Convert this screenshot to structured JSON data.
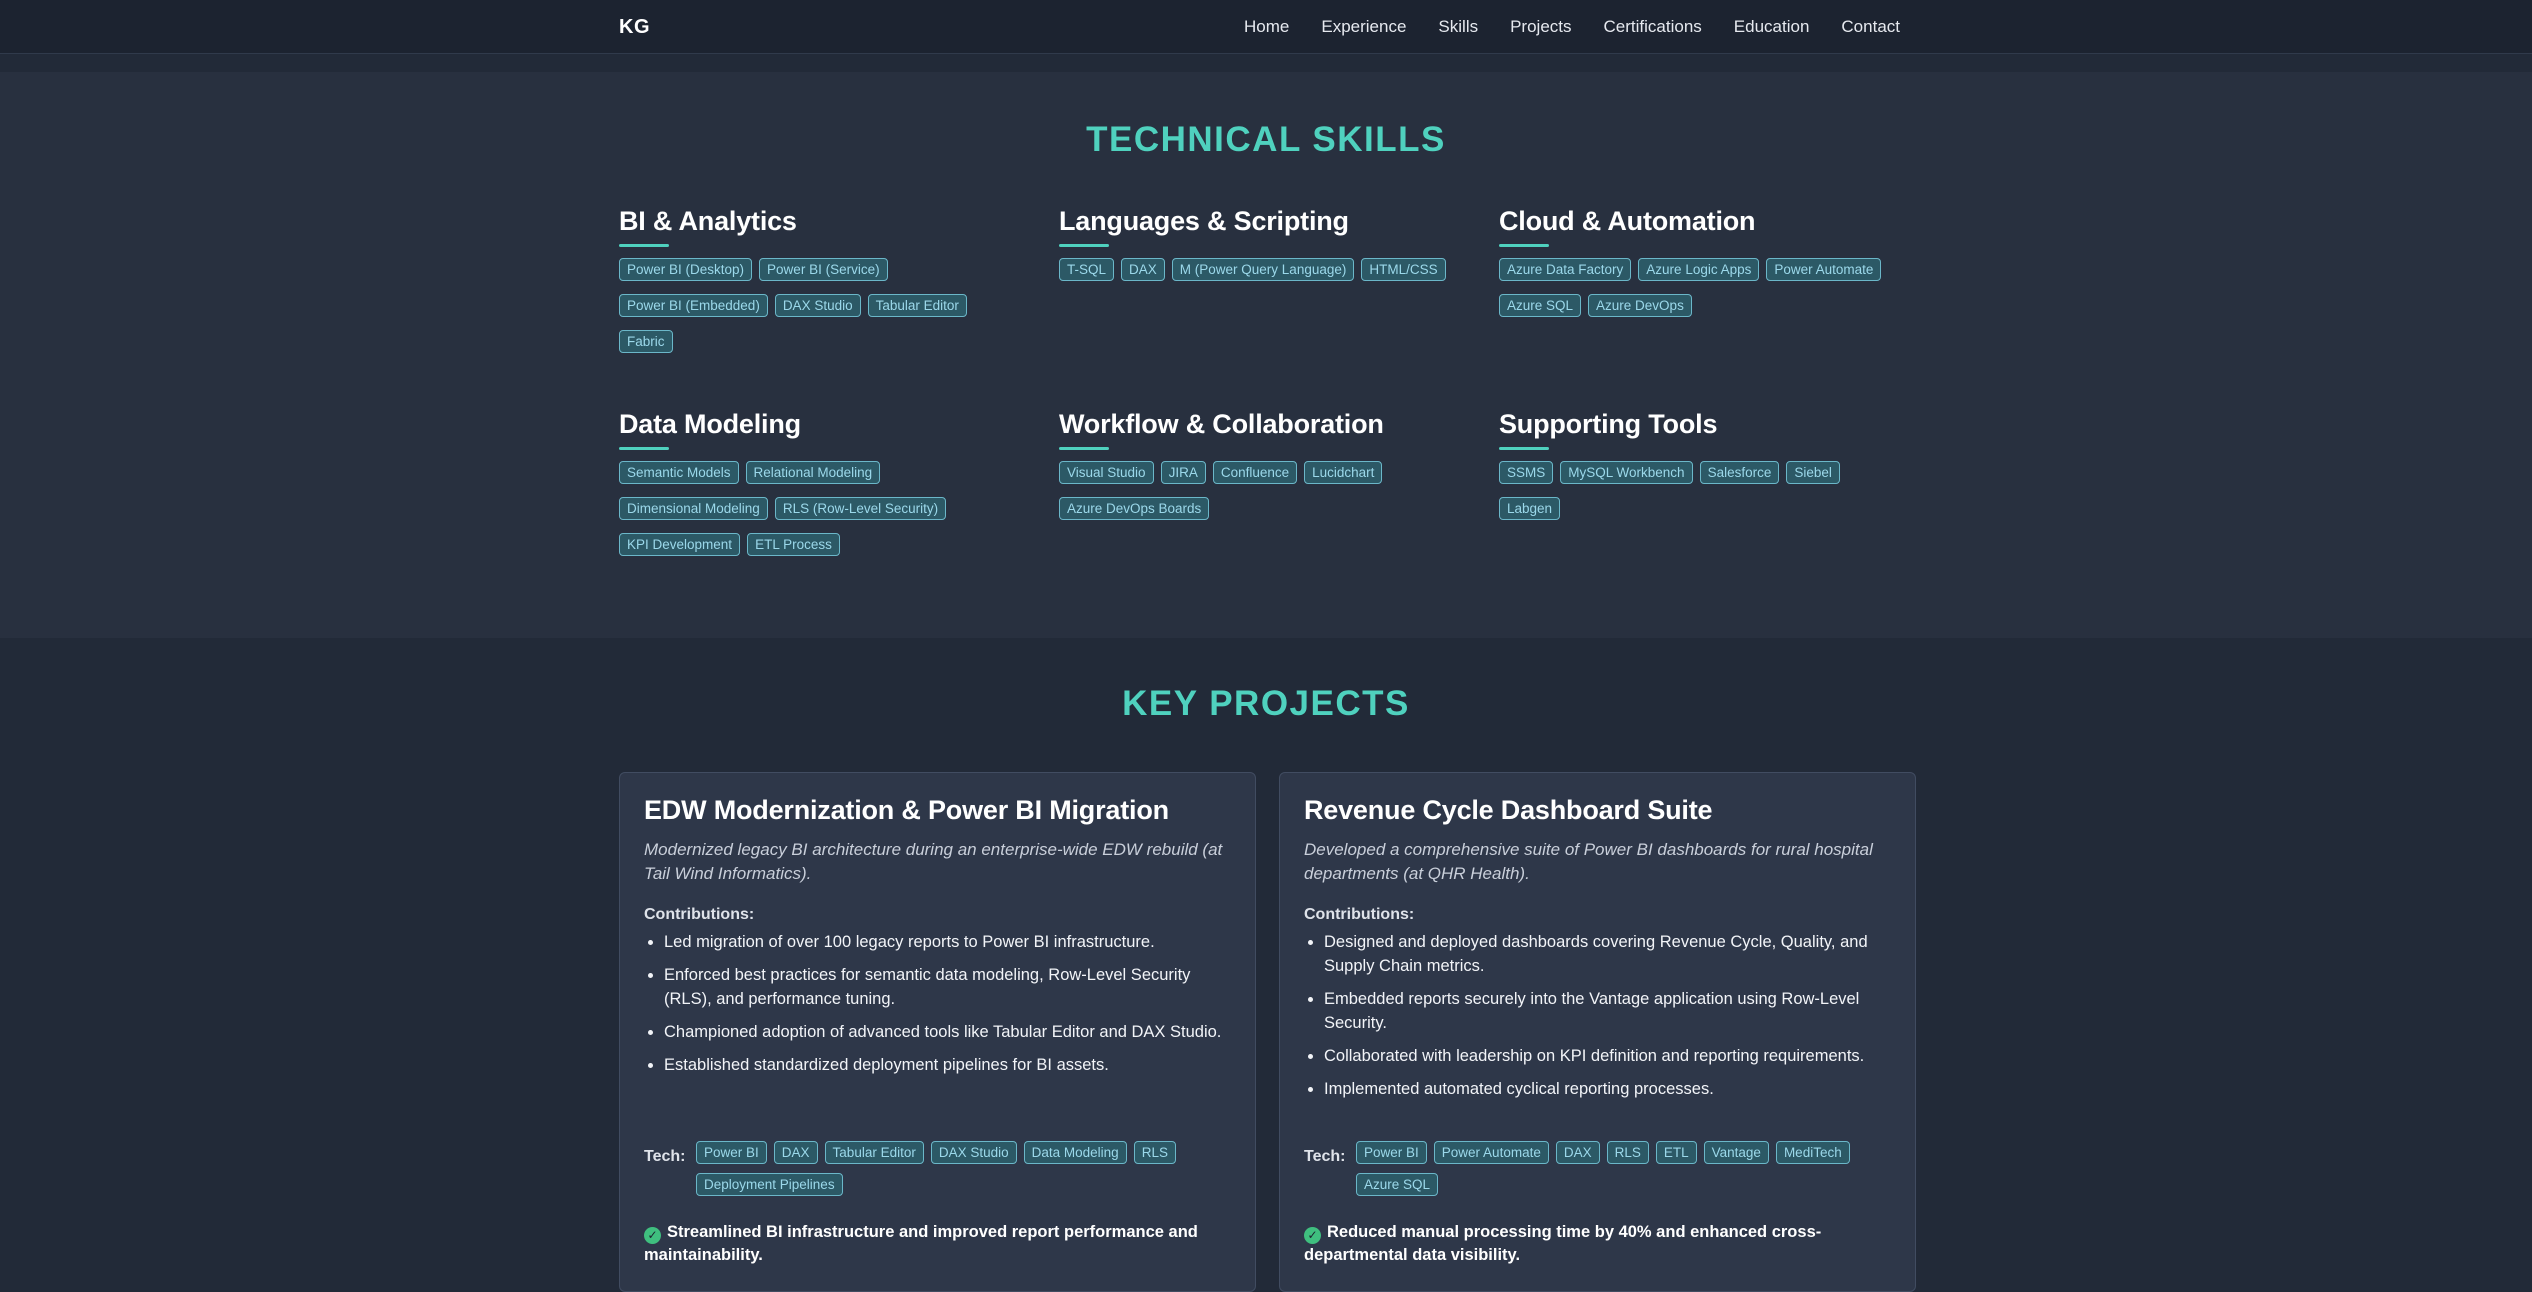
{
  "nav": {
    "logo": "KG",
    "links": [
      "Home",
      "Experience",
      "Skills",
      "Projects",
      "Certifications",
      "Education",
      "Contact"
    ]
  },
  "skills": {
    "title": "TECHNICAL SKILLS",
    "categories": [
      {
        "name": "BI & Analytics",
        "tags": [
          "Power BI (Desktop)",
          "Power BI (Service)",
          "Power BI (Embedded)",
          "DAX Studio",
          "Tabular Editor",
          "Fabric"
        ]
      },
      {
        "name": "Languages & Scripting",
        "tags": [
          "T-SQL",
          "DAX",
          "M (Power Query Language)",
          "HTML/CSS"
        ]
      },
      {
        "name": "Cloud & Automation",
        "tags": [
          "Azure Data Factory",
          "Azure Logic Apps",
          "Power Automate",
          "Azure SQL",
          "Azure DevOps"
        ]
      },
      {
        "name": "Data Modeling",
        "tags": [
          "Semantic Models",
          "Relational Modeling",
          "Dimensional Modeling",
          "RLS (Row-Level Security)",
          "KPI Development",
          "ETL Process"
        ]
      },
      {
        "name": "Workflow & Collaboration",
        "tags": [
          "Visual Studio",
          "JIRA",
          "Confluence",
          "Lucidchart",
          "Azure DevOps Boards"
        ]
      },
      {
        "name": "Supporting Tools",
        "tags": [
          "SSMS",
          "MySQL Workbench",
          "Salesforce",
          "Siebel",
          "Labgen"
        ]
      }
    ]
  },
  "projects": {
    "title": "KEY PROJECTS",
    "cards": [
      {
        "title": "EDW Modernization & Power BI Migration",
        "desc": "Modernized legacy BI architecture during an enterprise-wide EDW rebuild (at Tail Wind Informatics).",
        "contrib_label": "Contributions:",
        "items": [
          "Led migration of over 100 legacy reports to Power BI infrastructure.",
          "Enforced best practices for semantic data modeling, Row-Level Security (RLS), and performance tuning.",
          "Championed adoption of advanced tools like Tabular Editor and DAX Studio.",
          "Established standardized deployment pipelines for BI assets."
        ],
        "tech_label": "Tech:",
        "tech": [
          "Power BI",
          "DAX",
          "Tabular Editor",
          "DAX Studio",
          "Data Modeling",
          "RLS",
          "Deployment Pipelines"
        ],
        "outcome": "Streamlined BI infrastructure and improved report performance and maintainability."
      },
      {
        "title": "Revenue Cycle Dashboard Suite",
        "desc": "Developed a comprehensive suite of Power BI dashboards for rural hospital departments (at QHR Health).",
        "contrib_label": "Contributions:",
        "items": [
          "Designed and deployed dashboards covering Revenue Cycle, Quality, and Supply Chain metrics.",
          "Embedded reports securely into the Vantage application using Row-Level Security.",
          "Collaborated with leadership on KPI definition and reporting requirements.",
          "Implemented automated cyclical reporting processes."
        ],
        "tech_label": "Tech:",
        "tech": [
          "Power BI",
          "Power Automate",
          "DAX",
          "RLS",
          "ETL",
          "Vantage",
          "MediTech",
          "Azure SQL"
        ],
        "outcome": "Reduced manual processing time by 40% and enhanced cross-departmental data visibility."
      }
    ]
  }
}
